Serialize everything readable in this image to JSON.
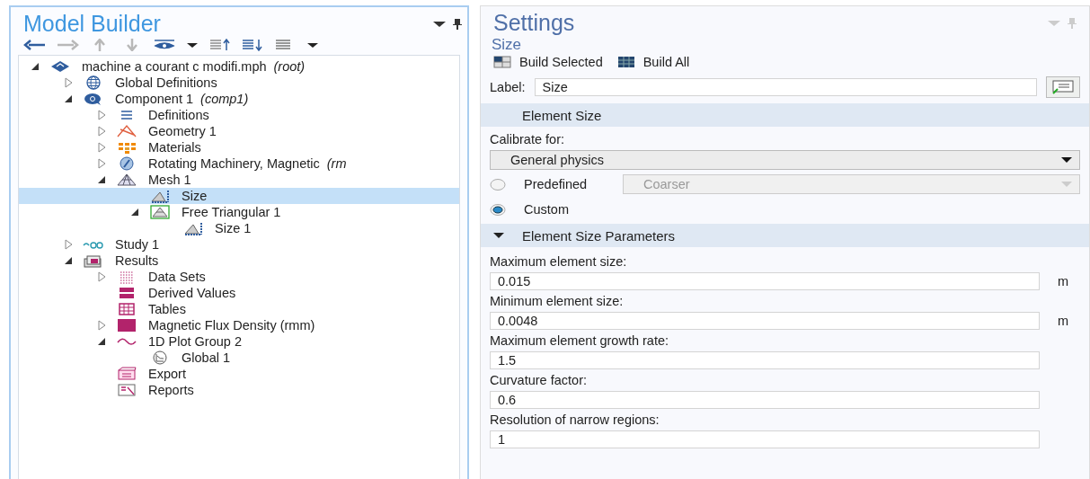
{
  "model_builder": {
    "title": "Model Builder",
    "toolbar": [
      {
        "kind": "back",
        "disabled": false
      },
      {
        "kind": "forward",
        "disabled": true
      },
      {
        "kind": "up",
        "disabled": true
      },
      {
        "kind": "down",
        "disabled": true
      },
      {
        "kind": "eye",
        "disabled": false
      },
      {
        "kind": "caret",
        "disabled": false
      },
      {
        "kind": "expand",
        "disabled": false
      },
      {
        "kind": "collapse",
        "disabled": false
      },
      {
        "kind": "list",
        "disabled": false
      },
      {
        "kind": "caret",
        "disabled": false
      }
    ],
    "tree": [
      {
        "label": "machine a courant c modifi.mph",
        "note": "(root)",
        "kind": "model",
        "expanded": true,
        "selected": false,
        "children": [
          {
            "label": "Global Definitions",
            "kind": "globe",
            "expanded": false,
            "selected": false
          },
          {
            "label": "Component 1",
            "note": "(comp1)",
            "kind": "component",
            "expanded": true,
            "selected": false,
            "children": [
              {
                "label": "Definitions",
                "kind": "definitions",
                "expanded": false,
                "selected": false
              },
              {
                "label": "Geometry 1",
                "kind": "geometry",
                "expanded": false,
                "selected": false
              },
              {
                "label": "Materials",
                "kind": "materials",
                "expanded": false,
                "selected": false
              },
              {
                "label": "Rotating Machinery, Magnetic",
                "note": "(rm",
                "kind": "rotating",
                "expanded": false,
                "selected": false
              },
              {
                "label": "Mesh 1",
                "kind": "mesh",
                "expanded": true,
                "selected": false,
                "children": [
                  {
                    "label": "Size",
                    "kind": "size",
                    "selected": true
                  },
                  {
                    "label": "Free Triangular 1",
                    "kind": "freetri",
                    "expanded": true,
                    "selected": false,
                    "children": [
                      {
                        "label": "Size 1",
                        "kind": "size",
                        "selected": false
                      }
                    ]
                  }
                ]
              }
            ]
          },
          {
            "label": "Study 1",
            "kind": "study",
            "expanded": false,
            "selected": false
          },
          {
            "label": "Results",
            "kind": "results",
            "expanded": true,
            "selected": false,
            "children": [
              {
                "label": "Data Sets",
                "kind": "datasets",
                "expanded": false,
                "selected": false
              },
              {
                "label": "Derived Values",
                "kind": "derived",
                "selected": false
              },
              {
                "label": "Tables",
                "kind": "tables",
                "selected": false
              },
              {
                "label": "Magnetic Flux Density (rmm)",
                "kind": "surface",
                "expanded": false,
                "selected": false
              },
              {
                "label": "1D Plot Group 2",
                "kind": "plot1d",
                "expanded": true,
                "selected": false,
                "children": [
                  {
                    "label": "Global 1",
                    "kind": "global",
                    "selected": false
                  }
                ]
              },
              {
                "label": "Export",
                "kind": "export",
                "selected": false
              },
              {
                "label": "Reports",
                "kind": "reports",
                "selected": false
              }
            ]
          }
        ]
      }
    ]
  },
  "settings": {
    "title": "Settings",
    "subtitle": "Size",
    "toolbar": [
      {
        "kind": "build-selected",
        "label": "Build Selected"
      },
      {
        "kind": "build-all",
        "label": "Build All"
      }
    ],
    "label_field": {
      "label": "Label:",
      "value": "Size"
    },
    "element_size": {
      "title": "Element Size",
      "calibrate_label": "Calibrate for:",
      "calibrate_value": "General physics",
      "options": [
        {
          "label": "Predefined",
          "selected": false,
          "value": "Coarser"
        },
        {
          "label": "Custom",
          "selected": true
        }
      ]
    },
    "parameters": {
      "title": "Element Size Parameters",
      "expanded": true,
      "fields": [
        {
          "label": "Maximum element size:",
          "value": "0.015",
          "unit": "m"
        },
        {
          "label": "Minimum element size:",
          "value": "0.0048",
          "unit": "m"
        },
        {
          "label": "Maximum element growth rate:",
          "value": "1.5"
        },
        {
          "label": "Curvature factor:",
          "value": "0.6"
        },
        {
          "label": "Resolution of narrow regions:",
          "value": "1"
        }
      ]
    }
  }
}
